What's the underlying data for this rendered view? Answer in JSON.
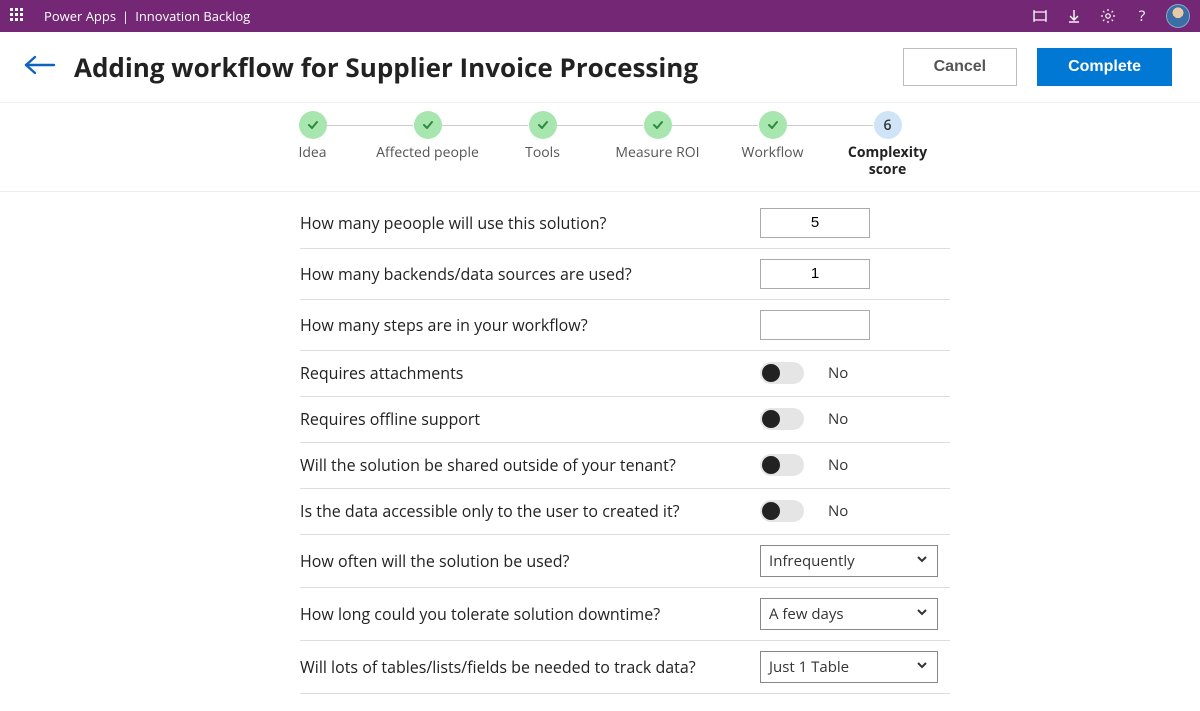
{
  "header": {
    "brand": "Power Apps",
    "separator": "|",
    "app_name": "Innovation Backlog"
  },
  "page": {
    "title": "Adding workflow for Supplier Invoice Processing",
    "cancel_label": "Cancel",
    "complete_label": "Complete"
  },
  "stepper": {
    "steps": [
      {
        "label": "Idea",
        "done": true
      },
      {
        "label": "Affected people",
        "done": true
      },
      {
        "label": "Tools",
        "done": true
      },
      {
        "label": "Measure ROI",
        "done": true
      },
      {
        "label": "Workflow",
        "done": true
      }
    ],
    "current": {
      "label": "Complexity score",
      "number": "6"
    }
  },
  "form": {
    "q_users": "How many peoople will use this solution?",
    "v_users": "5",
    "q_backends": "How many backends/data sources are  used?",
    "v_backends": "1",
    "q_steps": "How many steps are in your workflow?",
    "v_steps": "",
    "q_attachments": "Requires attachments",
    "v_attachments": "No",
    "q_offline": "Requires offline support",
    "v_offline": "No",
    "q_shared": "Will the solution be shared  outside of your tenant?",
    "v_shared": "No",
    "q_dataaccess": "Is the data accessible only to the user to created it?",
    "v_dataaccess": "No",
    "q_frequency": "How often will the solution be used?",
    "v_frequency": "Infrequently",
    "q_downtime": "How long could you tolerate solution downtime?",
    "v_downtime": "A few days",
    "q_tables": "Will lots of tables/lists/fields be needed to track data?",
    "v_tables": "Just 1 Table"
  }
}
